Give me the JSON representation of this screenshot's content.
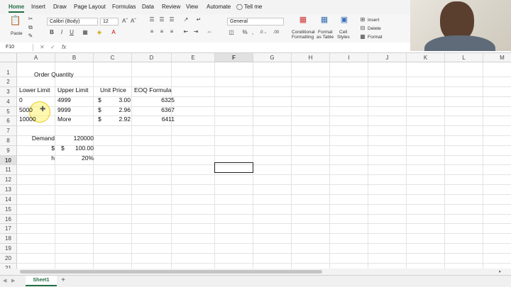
{
  "ribbon_tabs": [
    "Home",
    "Insert",
    "Draw",
    "Page Layout",
    "Formulas",
    "Data",
    "Review",
    "View",
    "Automate",
    "Tell me"
  ],
  "clipboard": {
    "paste_label": "Paste"
  },
  "font": {
    "name": "Calibri (Body)",
    "size": "12"
  },
  "number_format": {
    "value": "General"
  },
  "styles": {
    "conditional_formatting_line1": "Conditional",
    "conditional_formatting_line2": "Formatting",
    "format_as_table_line1": "Format",
    "format_as_table_line2": "as Table",
    "cell_styles_line1": "Cell",
    "cell_styles_line2": "Styles"
  },
  "cells_group": {
    "insert": "Insert",
    "delete": "Delete",
    "format": "Format"
  },
  "name_box": "F10",
  "fx": "fx",
  "columns": [
    "A",
    "B",
    "C",
    "D",
    "E",
    "F",
    "G",
    "H",
    "I",
    "J",
    "K",
    "L",
    "M"
  ],
  "rows": [
    "1",
    "2",
    "3",
    "4",
    "5",
    "6",
    "7",
    "8",
    "9",
    "10",
    "11",
    "12",
    "13",
    "14",
    "15",
    "16",
    "17",
    "18",
    "19",
    "20",
    "21"
  ],
  "sheet": {
    "a1": "Order Quantity",
    "a2": "Lower Limit",
    "b2": "Upper Limit",
    "c2": "Unit Price",
    "d2": "EOQ Formula",
    "a3": "0",
    "b3": "4999",
    "c3_cur": "$",
    "c3": "3.00",
    "d3": "6325",
    "a4": "5000",
    "b4": "9999",
    "c4_cur": "$",
    "c4": "2.96",
    "d4": "6367",
    "a5": "10000",
    "b5": "More",
    "c5_cur": "$",
    "c5": "2.92",
    "d5": "6411",
    "a7": "Demand",
    "b7": "120000",
    "a8": "$",
    "b8_cur": "$",
    "b8": "100.00",
    "a9": "h",
    "b9": "20%"
  },
  "sheet_tab": "Sheet1",
  "add_sheet": "+"
}
